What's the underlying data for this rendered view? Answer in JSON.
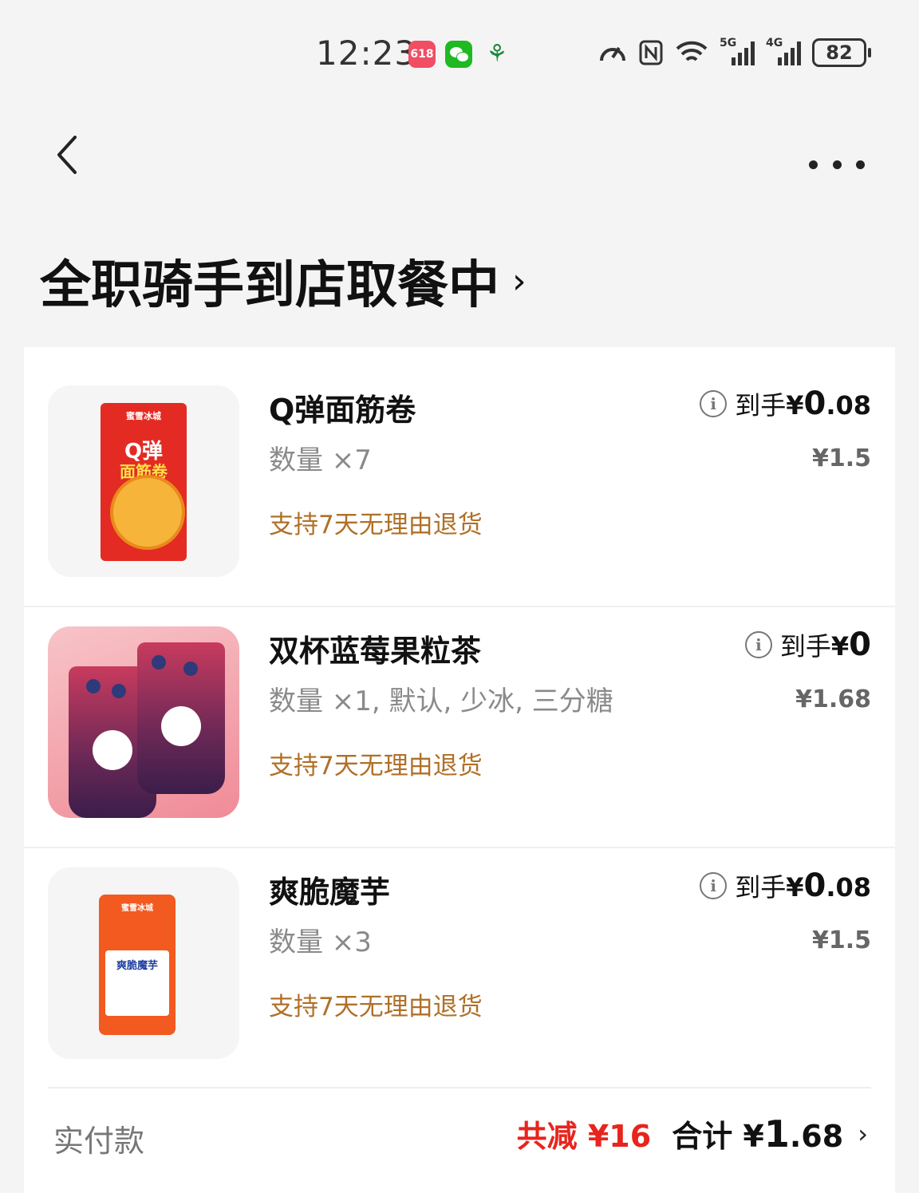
{
  "status_bar": {
    "time": "12:23",
    "app_618": "618",
    "battery": "82",
    "signal_1": "5G",
    "signal_2": "4G"
  },
  "header": {
    "title": "全职骑手到店取餐中",
    "title_chevron": "›"
  },
  "items": [
    {
      "name": "Q弹面筋卷",
      "qty": "数量 ×7",
      "final_label": "到手",
      "final_currency": "¥",
      "final_int": "0",
      "final_dec": ".08",
      "original_price": "¥1.5",
      "return_policy": "支持7天无理由退货",
      "thumb_text_1": "Q弹",
      "thumb_text_2": "面筋卷"
    },
    {
      "name": "双杯蓝莓果粒茶",
      "qty": "数量 ×1, 默认, 少冰, 三分糖",
      "final_label": "到手",
      "final_currency": "¥",
      "final_int": "0",
      "final_dec": "",
      "original_price": "¥1.68",
      "return_policy": "支持7天无理由退货"
    },
    {
      "name": "爽脆魔芋",
      "qty": "数量 ×3",
      "final_label": "到手",
      "final_currency": "¥",
      "final_int": "0",
      "final_dec": ".08",
      "original_price": "¥1.5",
      "return_policy": "支持7天无理由退货",
      "thumb_text": "爽脆魔芋"
    }
  ],
  "summary": {
    "label": "实付款",
    "saved": "共减 ¥16",
    "total_label": "合计 ¥",
    "total_int": "1",
    "total_dec": ".68",
    "chevron": "›"
  },
  "colors": {
    "accent_red": "#e8241c",
    "return_policy": "#b07028"
  }
}
